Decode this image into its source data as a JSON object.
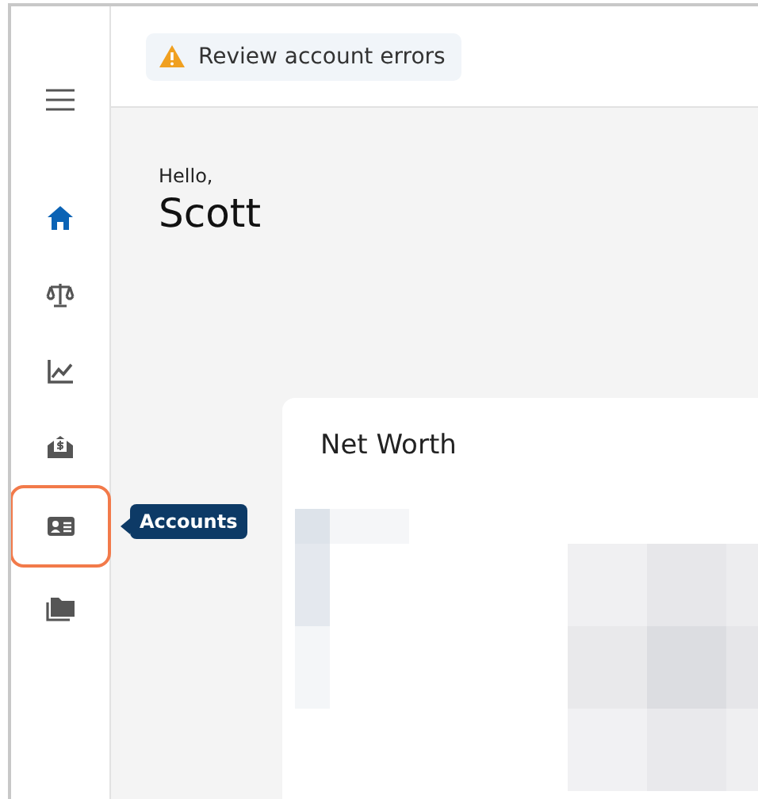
{
  "alert": {
    "kind": "warning",
    "text": "Review account errors"
  },
  "sidebar": {
    "items": [
      {
        "selected": true,
        "highlighted": false
      },
      {
        "selected": false,
        "highlighted": false
      },
      {
        "selected": false,
        "highlighted": false
      },
      {
        "selected": false,
        "highlighted": false
      },
      {
        "selected": false,
        "highlighted": true,
        "tooltip": "Accounts"
      },
      {
        "selected": false,
        "highlighted": false
      }
    ]
  },
  "greeting": {
    "salutation": "Hello,",
    "name": "Scott"
  },
  "card": {
    "title": "Net Worth",
    "content": {
      "kind": "pixelated"
    }
  }
}
